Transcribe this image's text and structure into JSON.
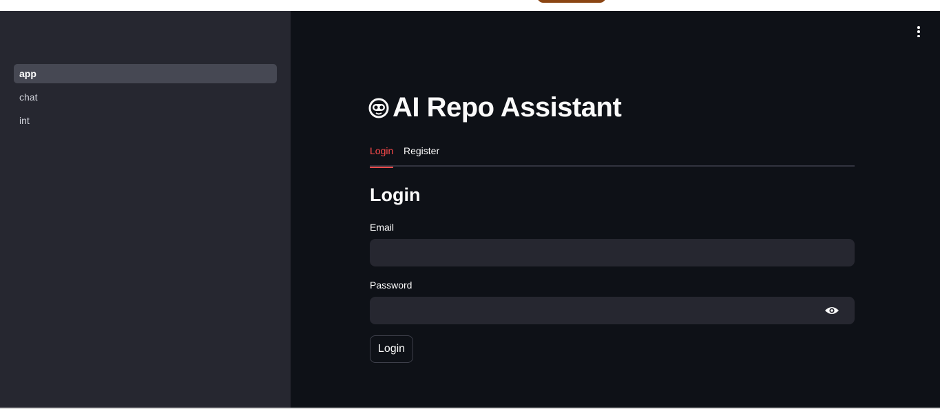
{
  "sidebar": {
    "items": [
      {
        "label": "app",
        "active": true
      },
      {
        "label": "chat",
        "active": false
      },
      {
        "label": "int",
        "active": false
      }
    ]
  },
  "header": {
    "menu_icon": "vertical-dots-icon"
  },
  "main": {
    "title": "AI Repo Assistant",
    "title_icon": "robot-face-icon",
    "tabs": [
      {
        "label": "Login",
        "active": true
      },
      {
        "label": "Register",
        "active": false
      }
    ],
    "section_title": "Login",
    "email": {
      "label": "Email",
      "value": "",
      "placeholder": ""
    },
    "password": {
      "label": "Password",
      "value": "",
      "placeholder": "",
      "toggle_icon": "eye-icon"
    },
    "submit_label": "Login"
  },
  "colors": {
    "sidebar_bg": "#262730",
    "main_bg": "#0e1117",
    "accent": "#ff4b4b",
    "input_bg": "#262730",
    "topbar_pill": "#8b4513"
  }
}
